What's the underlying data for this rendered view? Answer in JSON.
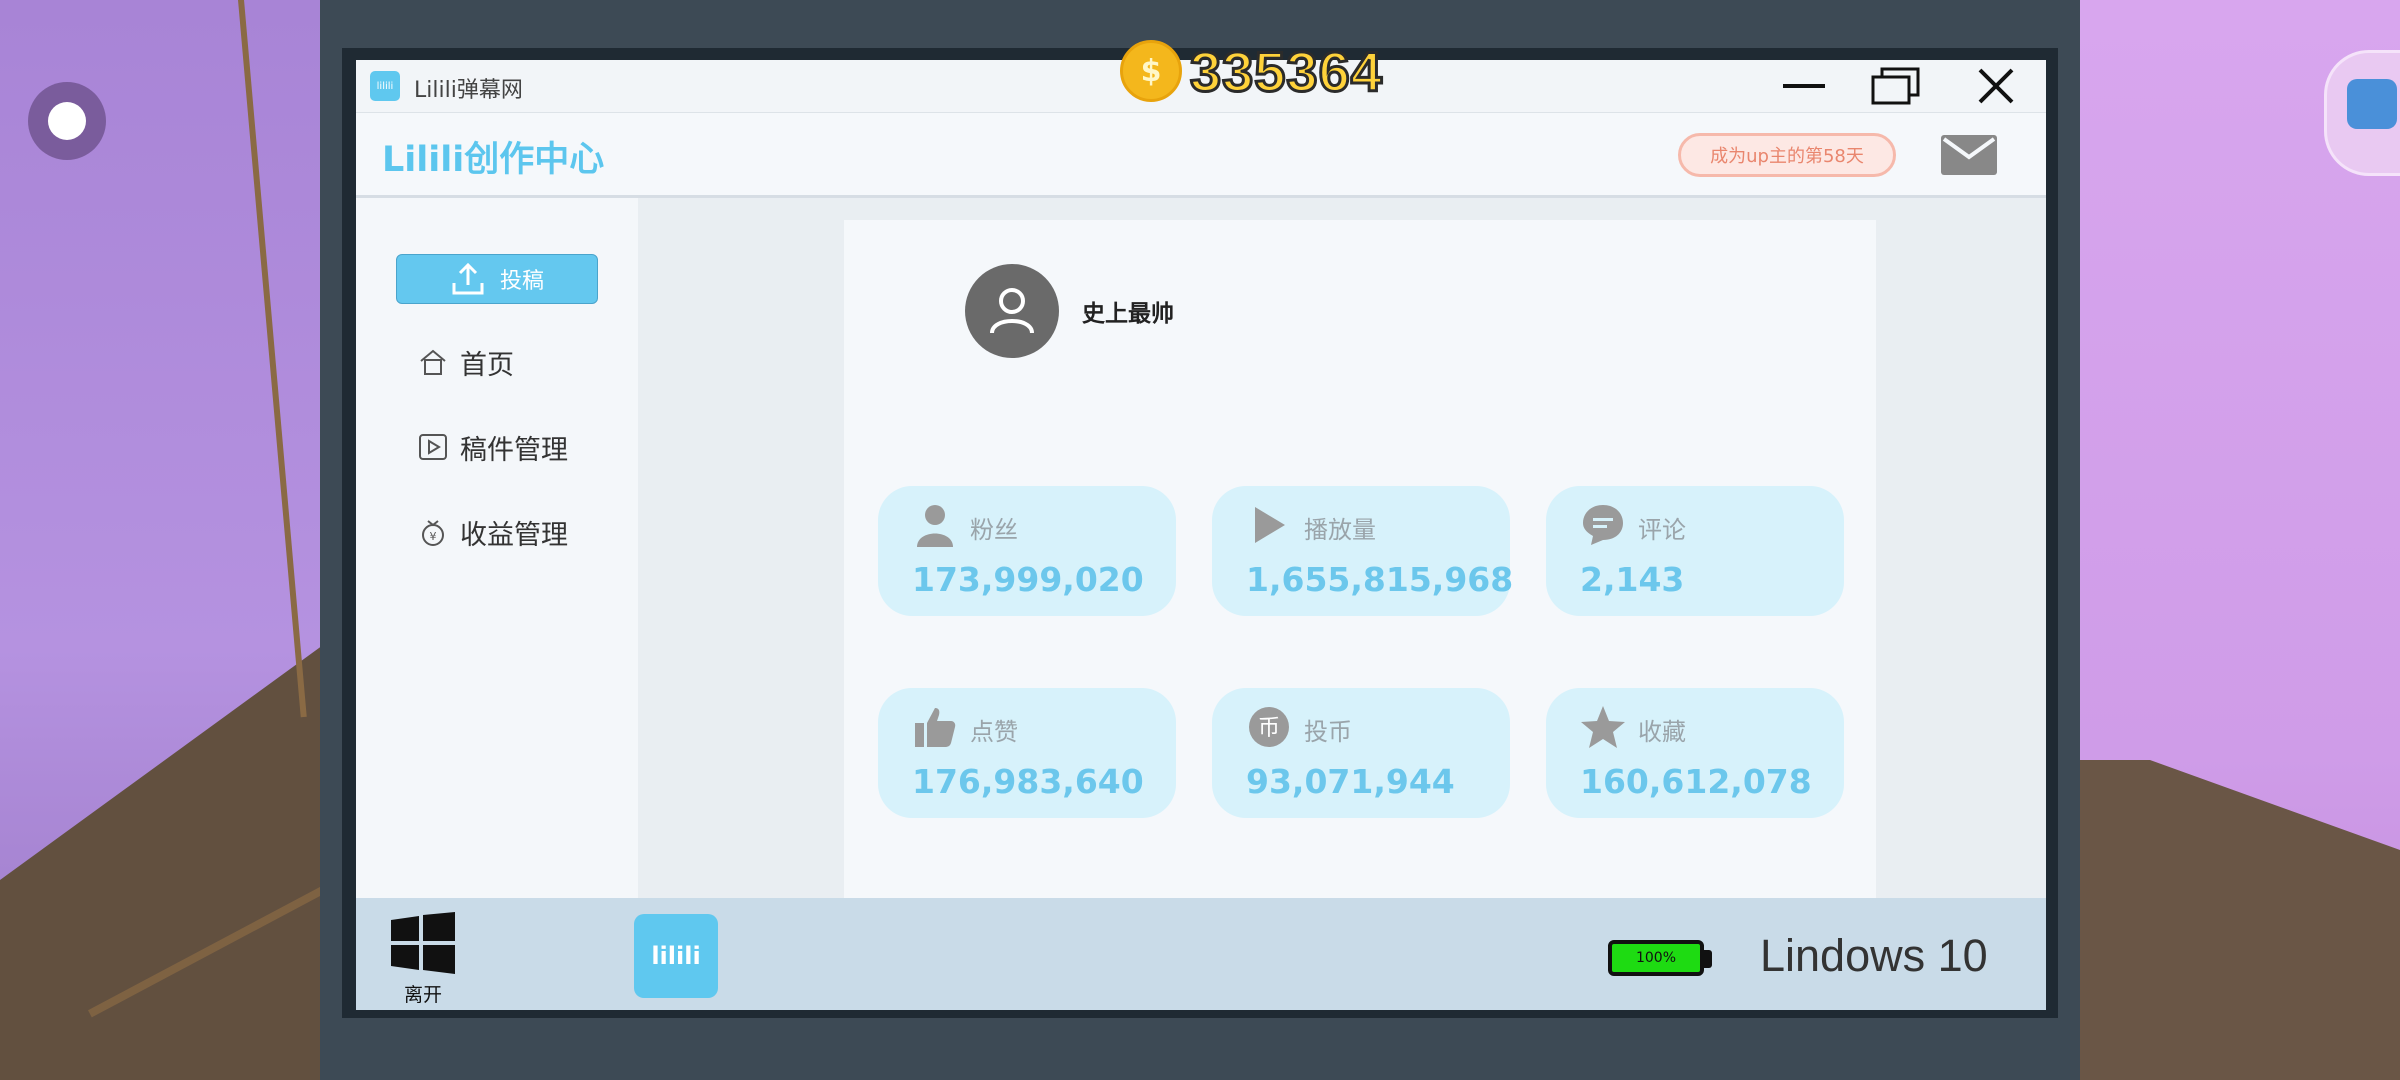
{
  "hud": {
    "coins": "335364"
  },
  "window": {
    "title": "Lilili弹幕网",
    "app_icon_text": "lilili"
  },
  "header": {
    "brand": "Lilili创作中心",
    "up_days": "成为up主的第58天"
  },
  "sidebar": {
    "upload_label": "投稿",
    "items": [
      {
        "label": "首页",
        "icon": "home-icon"
      },
      {
        "label": "稿件管理",
        "icon": "video-icon"
      },
      {
        "label": "收益管理",
        "icon": "money-bag-icon"
      }
    ]
  },
  "profile": {
    "username": "史上最帅"
  },
  "stats": [
    {
      "label": "粉丝",
      "value": "173,999,020",
      "icon": "person-icon"
    },
    {
      "label": "播放量",
      "value": "1,655,815,968",
      "icon": "play-icon"
    },
    {
      "label": "评论",
      "value": "2,143",
      "icon": "comment-icon"
    },
    {
      "label": "点赞",
      "value": "176,983,640",
      "icon": "thumbs-up-icon"
    },
    {
      "label": "投币",
      "value": "93,071,944",
      "icon": "coin-icon"
    },
    {
      "label": "收藏",
      "value": "160,612,078",
      "icon": "star-icon"
    }
  ],
  "taskbar": {
    "start_label": "离开",
    "app_label": "lilili",
    "battery": "100%",
    "os_name": "Lindows 10"
  },
  "colors": {
    "accent": "#5cc6ee",
    "stat_bg": "#d7f2fb",
    "battery": "#1edb12",
    "coin_text": "#ffd23a"
  }
}
